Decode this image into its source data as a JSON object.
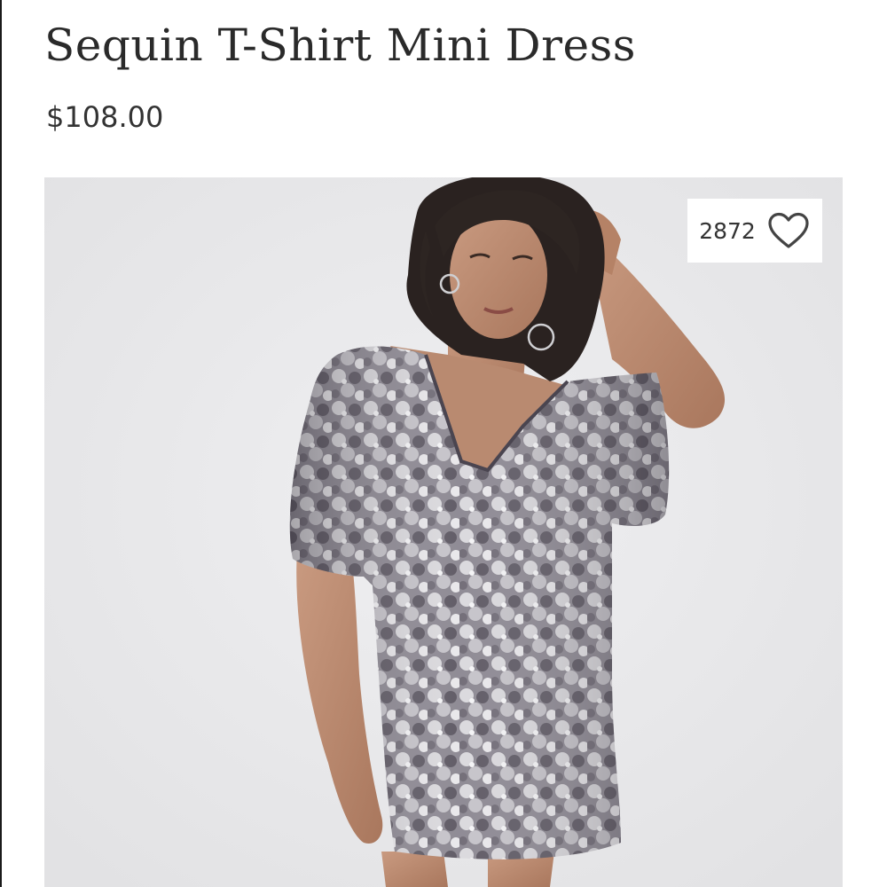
{
  "product": {
    "title": "Sequin T-Shirt Mini Dress",
    "price": "$108.00",
    "image_icon": "product-photo",
    "favorites": {
      "count": "2872",
      "icon": "heart-outline-icon"
    }
  },
  "colors": {
    "background": "#ffffff",
    "text": "#2a2a2a",
    "photo_backdrop": "#e7e7e9",
    "dress_silver": "#b9b7bd",
    "dress_dark": "#4b4650"
  }
}
